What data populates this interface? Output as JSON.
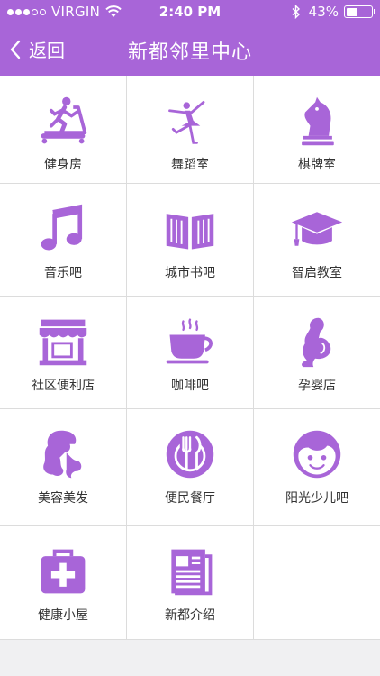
{
  "status_bar": {
    "carrier": "VIRGIN",
    "time": "2:40 PM",
    "battery": "43%",
    "battery_level": 0.43
  },
  "nav": {
    "back_label": "返回",
    "title": "新都邻里中心"
  },
  "accent_color": "#a865d8",
  "services": [
    {
      "label": "健身房",
      "icon": "treadmill-icon"
    },
    {
      "label": "舞蹈室",
      "icon": "ballerina-icon"
    },
    {
      "label": "棋牌室",
      "icon": "chess-knight-icon"
    },
    {
      "label": "音乐吧",
      "icon": "music-note-icon"
    },
    {
      "label": "城市书吧",
      "icon": "open-book-icon"
    },
    {
      "label": "智启教室",
      "icon": "graduation-cap-icon"
    },
    {
      "label": "社区便利店",
      "icon": "storefront-icon"
    },
    {
      "label": "咖啡吧",
      "icon": "coffee-cup-icon"
    },
    {
      "label": "孕婴店",
      "icon": "pregnant-woman-icon"
    },
    {
      "label": "美容美发",
      "icon": "hair-salon-icon"
    },
    {
      "label": "便民餐厅",
      "icon": "restaurant-icon"
    },
    {
      "label": "阳光少儿吧",
      "icon": "child-face-icon"
    },
    {
      "label": "健康小屋",
      "icon": "medical-kit-icon"
    },
    {
      "label": "新都介绍",
      "icon": "newspaper-icon"
    }
  ]
}
